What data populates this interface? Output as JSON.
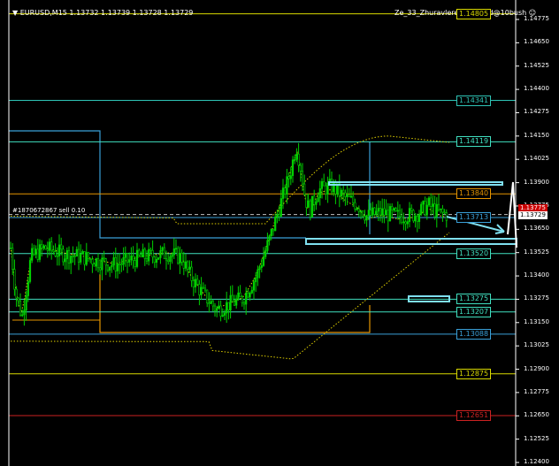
{
  "header": {
    "symbol_info": "EURUSD,M15  1.13732 1.13739 1.13728 1.13729",
    "indicator_label": "Ze_33_Zhuravlereska...V Sd@10bush"
  },
  "trade_line": {
    "label": "#1870672867 sell 0.10",
    "price": 1.13729
  },
  "price_axis": {
    "ticks": [
      "1.14775",
      "1.14650",
      "1.14525",
      "1.14400",
      "1.14275",
      "1.14150",
      "1.14025",
      "1.13900",
      "1.13775",
      "1.13650",
      "1.13525",
      "1.13400",
      "1.13275",
      "1.13150",
      "1.13025",
      "1.12900",
      "1.12775",
      "1.12650",
      "1.12525",
      "1.12400"
    ],
    "current_price": "1.13729",
    "bid_price": "1.13775"
  },
  "levels": [
    {
      "label": "1.14805",
      "value": 1.14805,
      "color": "#d9d900"
    },
    {
      "label": "1.14341",
      "value": 1.14341,
      "color": "#2ec4b6"
    },
    {
      "label": "1.14119",
      "value": 1.14119,
      "color": "#40e0c0"
    },
    {
      "label": "1.13840",
      "value": 1.1384,
      "color": "#e69500"
    },
    {
      "label": "1.13713",
      "value": 1.13713,
      "color": "#3aa0d8"
    },
    {
      "label": "1.13520",
      "value": 1.1352,
      "color": "#40e0c0"
    },
    {
      "label": "1.13275",
      "value": 1.13275,
      "color": "#40e0c0"
    },
    {
      "label": "1.13207",
      "value": 1.13207,
      "color": "#40e0c0"
    },
    {
      "label": "1.13088",
      "value": 1.13088,
      "color": "#3aa0d8"
    },
    {
      "label": "1.12875",
      "value": 1.12875,
      "color": "#d9d900"
    },
    {
      "label": "1.12651",
      "value": 1.12651,
      "color": "#cc2222"
    }
  ],
  "colors": {
    "background": "#000000",
    "bull_candle": "#00d000",
    "bear_candle": "#00d000",
    "grid_tag_bg": "#000000",
    "trade_line": "#c0c0c0",
    "bands": "#e0d000",
    "box_blue": "#3aa0d8",
    "box_orange": "#e69500",
    "annotation": "#7fe0f0",
    "current_bg": "#ffffff",
    "bid_bg": "#cc0000"
  }
}
